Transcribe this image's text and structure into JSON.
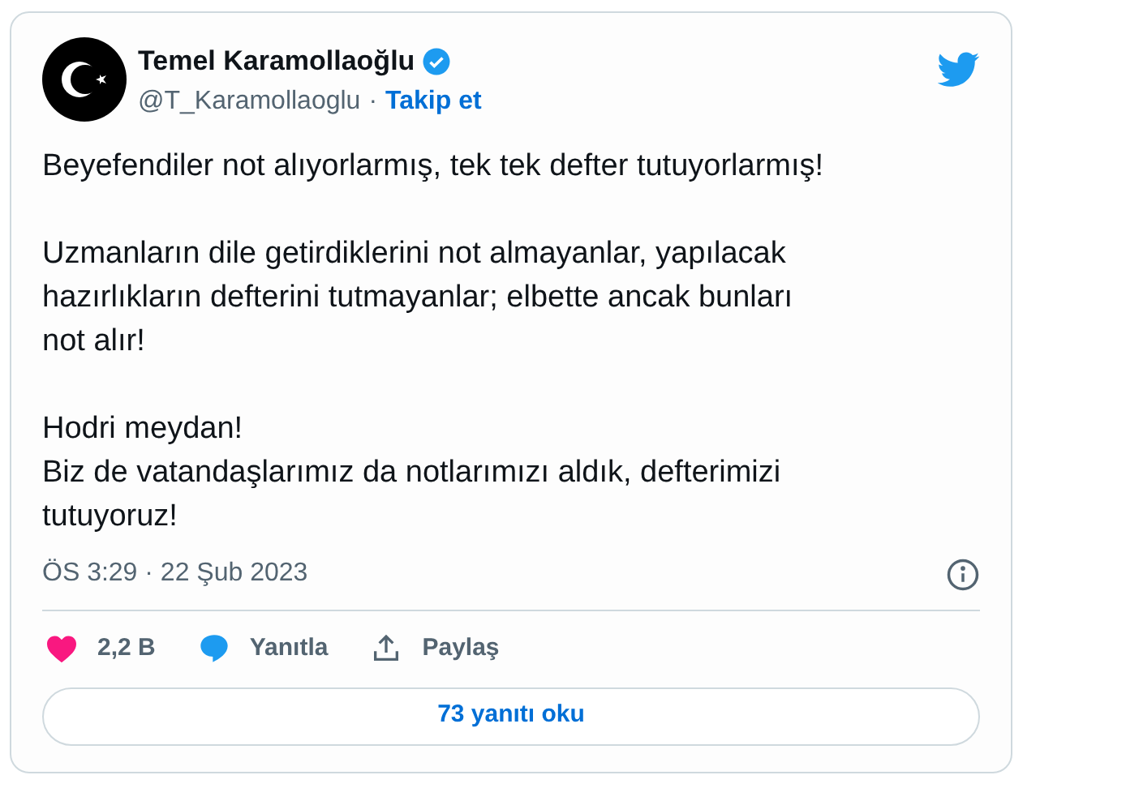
{
  "author": {
    "name": "Temel Karamollaoğlu",
    "verified": true,
    "handle": "@T_Karamollaoglu",
    "separator": "·",
    "follow": "Takip et"
  },
  "body": [
    [
      "Beyefendiler not alıyorlarmış, tek tek defter tutuyorlarmış!"
    ],
    [
      "Uzmanların dile getirdiklerini not almayanlar, yapılacak",
      "hazırlıkların defterini tutmayanlar; elbette ancak bunları",
      "not alır!"
    ],
    [
      "Hodri meydan!",
      "Biz de vatandaşlarımız da notlarımızı aldık, defterimizi",
      "tutuyoruz!"
    ]
  ],
  "timestamp": "ÖS 3:29 · 22 Şub 2023",
  "actions": [
    {
      "kind": "like",
      "label": "2,2 B"
    },
    {
      "kind": "reply",
      "label": "Yanıtla"
    },
    {
      "kind": "share",
      "label": "Paylaş"
    }
  ],
  "replies_button": "73 yanıtı oku"
}
